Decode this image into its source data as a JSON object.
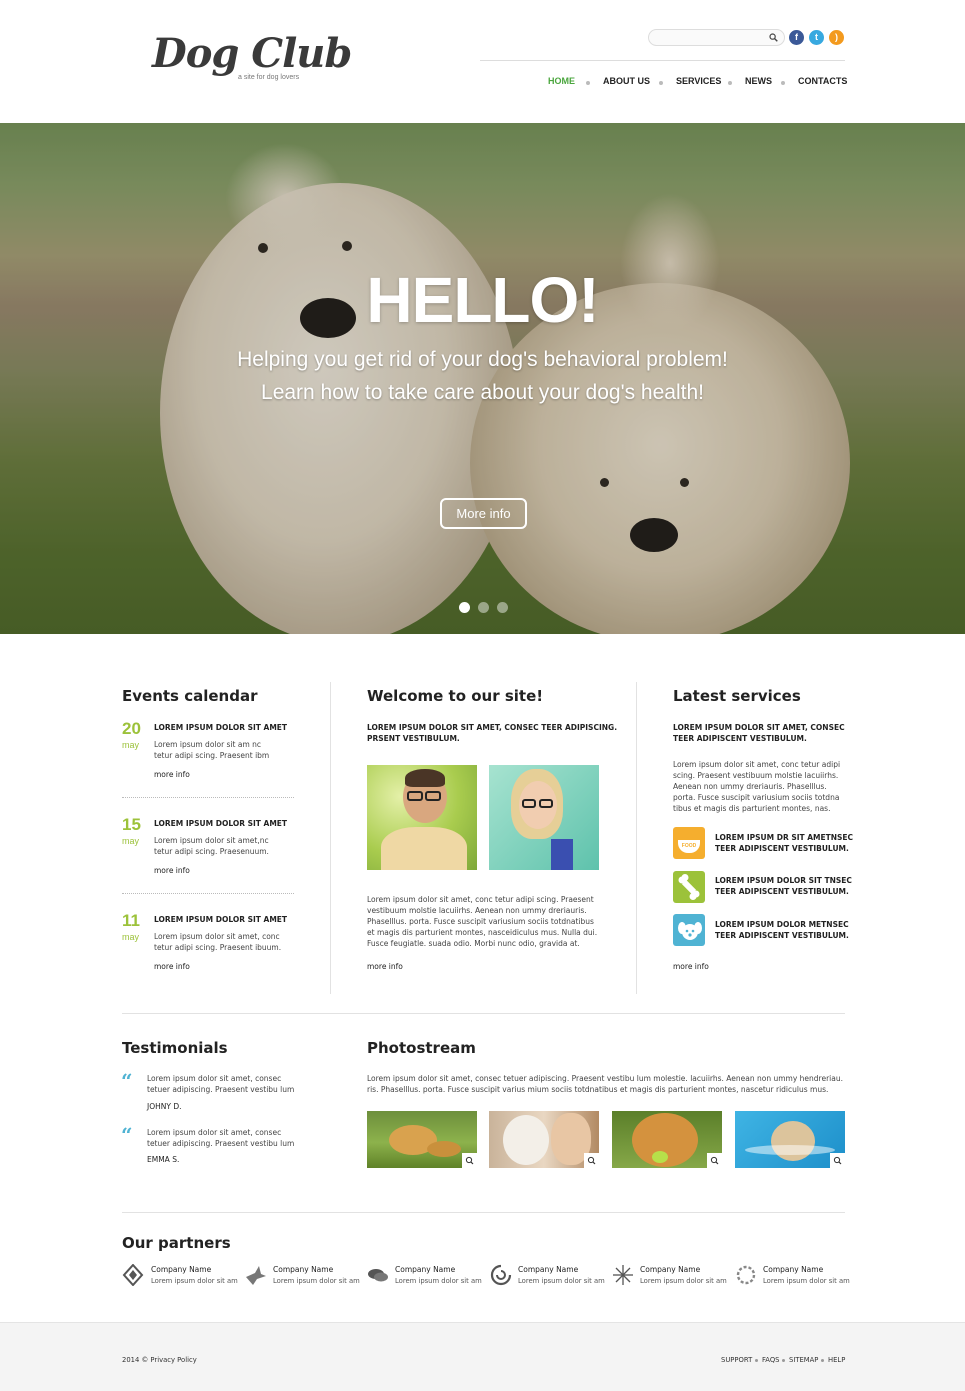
{
  "header": {
    "logo_title": "Dog Club",
    "logo_tagline": "a site for dog lovers",
    "search_placeholder": "",
    "social": [
      {
        "icon": "facebook-icon",
        "glyph": "f",
        "color": "#3b5998"
      },
      {
        "icon": "twitter-icon",
        "glyph": "t",
        "color": "#38a9e0"
      },
      {
        "icon": "rss-icon",
        "glyph": ")",
        "color": "#f39a1e"
      }
    ],
    "nav": [
      "HOME",
      "ABOUT US",
      "SERVICES",
      "NEWS",
      "CONTACTS"
    ],
    "active_nav": "HOME",
    "accent_color": "#4aa63d"
  },
  "hero": {
    "title": "HELLO!",
    "line1": "Helping you get rid of your dog's behavioral problem!",
    "line2": "Learn how to take care about your dog's health!",
    "button": "More info",
    "slides": 3,
    "active_slide": 1
  },
  "events": {
    "title": "Events calendar",
    "items": [
      {
        "day": "20",
        "month": "may",
        "heading": "LOREM IPSUM DOLOR SIT AMET",
        "line1": "Lorem ipsum dolor sit am nc",
        "line2": "tetur adipi scing. Praesent ibm",
        "more": "more info"
      },
      {
        "day": "15",
        "month": "may",
        "heading": "LOREM IPSUM DOLOR SIT AMET",
        "line1": "Lorem ipsum dolor sit amet,nc",
        "line2": "tetur adipi scing. Praesenuum.",
        "more": "more info"
      },
      {
        "day": "11",
        "month": "may",
        "heading": "LOREM IPSUM DOLOR SIT AMET",
        "line1": "Lorem ipsum dolor sit amet, conc",
        "line2": "tetur adipi scing. Praesent ibuum.",
        "more": "more info"
      }
    ],
    "accent_color": "#9cc23a"
  },
  "welcome": {
    "title": "Welcome to our site!",
    "intro1": "LOREM IPSUM DOLOR SIT AMET, CONSEC TEER ADIPISCING.",
    "intro2": "PRSENT VESTIBULUM.",
    "body": [
      "Lorem ipsum dolor sit amet, conc tetur adipi scing. Praesent",
      "vestibuum molstie lacuiirhs. Aenean non ummy dreriauris.",
      "Phaselllus. porta. Fusce suscipit variusium sociis totdnatibus",
      "et magis dis parturient montes, nasceidiculus mus. Nulla dui.",
      "Fusce feugiatle. suada odio. Morbi nunc odio, gravida at."
    ],
    "more": "more info"
  },
  "services": {
    "title": "Latest services",
    "intro1": "LOREM IPSUM DOLOR SIT AMET, CONSEC",
    "intro2": "TEER ADIPISCENT VESTIBULUM.",
    "body": [
      "Lorem ipsum dolor sit amet, conc tetur adipi",
      "scing. Praesent vestibuum molstie lacuiirhs.",
      "Aenean non ummy dreriauris. Phaselllus.",
      "porta. Fusce suscipit variusium sociis totdna",
      "tibus et magis dis parturient montes, nas."
    ],
    "items": [
      {
        "icon": "dog-food-icon",
        "badge": "FOOD",
        "color": "#f5ae2e",
        "line1": "LOREM IPSUM DR SIT AMETNSEC",
        "line2": "TEER ADIPISCENT VESTIBULUM."
      },
      {
        "icon": "bone-icon",
        "color": "#9cc23a",
        "line1": "LOREM IPSUM DOLOR SIT TNSEC",
        "line2": "TEER ADIPISCENT VESTIBULUM."
      },
      {
        "icon": "dog-head-icon",
        "color": "#4fb3d3",
        "line1": "LOREM IPSUM DOLOR METNSEC",
        "line2": "TEER ADIPISCENT VESTIBULUM."
      }
    ],
    "more": "more info"
  },
  "testimonials": {
    "title": "Testimonials",
    "items": [
      {
        "line1": "Lorem ipsum dolor sit amet, consec",
        "line2": "tetuer adipiscing. Praesent vestibu lum",
        "author": "JOHNY D."
      },
      {
        "line1": "Lorem ipsum dolor sit amet, consec",
        "line2": "tetuer adipiscing. Praesent vestibu lum",
        "author": "EMMA S."
      }
    ],
    "quote_glyph": "“",
    "accent_color": "#4fb3d3"
  },
  "photostream": {
    "title": "Photostream",
    "line1": "Lorem ipsum dolor sit amet, consec tetuer adipiscing. Praesent vestibu lum molestie. lacuiirhs. Aenean non ummy hendreriau.",
    "line2": "ris. Phaselllus. porta. Fusce suscipit varius mium sociis totdnatibus et magis dis parturient montes, nascetur ridiculus mus."
  },
  "partners": {
    "title": "Our partners",
    "items": [
      {
        "name": "Company Name",
        "desc": "Lorem ipsum dolor sit am",
        "icon": "diamond-logo-icon"
      },
      {
        "name": "Company Name",
        "desc": "Lorem ipsum dolor sit am",
        "icon": "origami-bird-logo-icon"
      },
      {
        "name": "Company Name",
        "desc": "Lorem ipsum dolor sit am",
        "icon": "speech-bubbles-logo-icon"
      },
      {
        "name": "Company Name",
        "desc": "Lorem ipsum dolor sit am",
        "icon": "swirl-logo-icon"
      },
      {
        "name": "Company Name",
        "desc": "Lorem ipsum dolor sit am",
        "icon": "starburst-logo-icon"
      },
      {
        "name": "Company Name",
        "desc": "Lorem ipsum dolor sit am",
        "icon": "ring-logo-icon"
      }
    ]
  },
  "footer": {
    "copyright": "2014 © Privacy Policy",
    "links": [
      "SUPPORT",
      "FAQS",
      "SITEMAP",
      "HELP"
    ]
  }
}
